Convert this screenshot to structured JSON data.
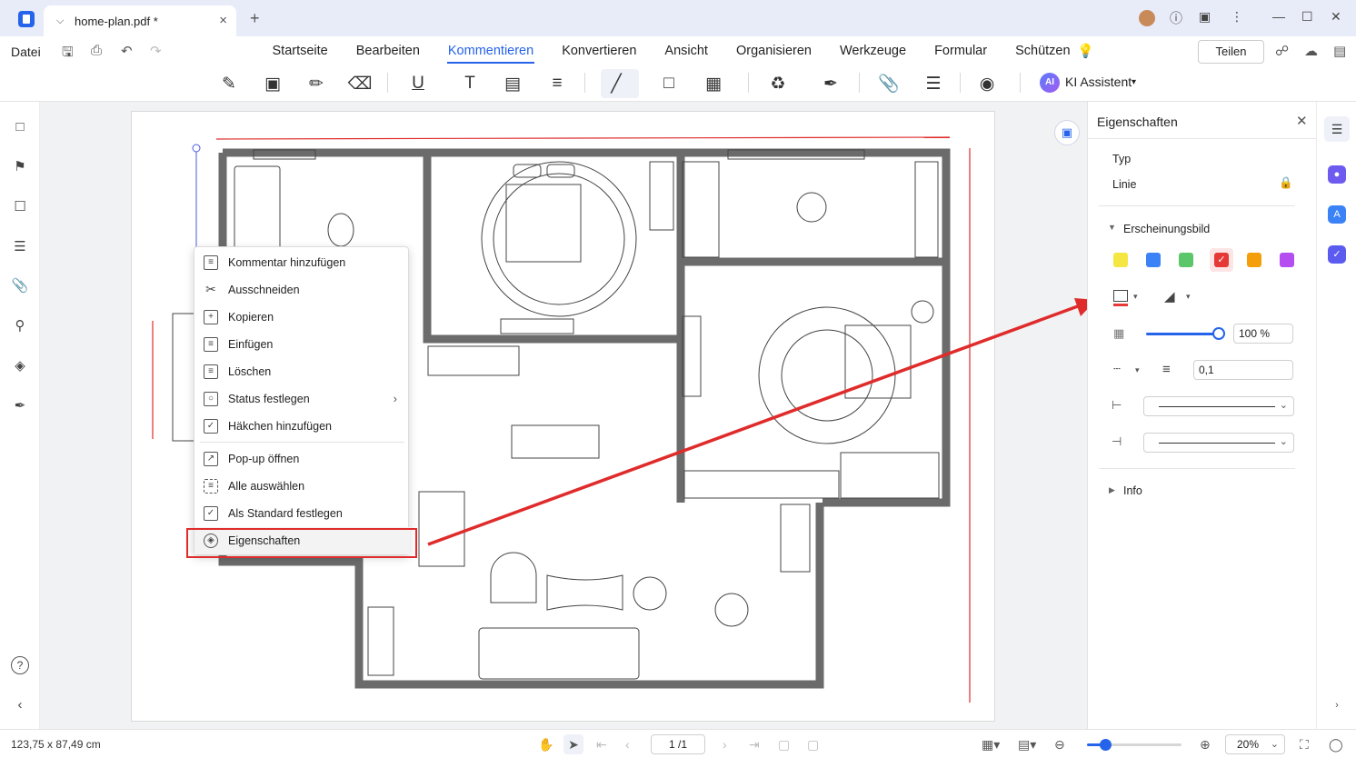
{
  "tab": {
    "title": "home-plan.pdf *"
  },
  "menubar": {
    "file": "Datei",
    "items": [
      "Startseite",
      "Bearbeiten",
      "Kommentieren",
      "Konvertieren",
      "Ansicht",
      "Organisieren",
      "Werkzeuge",
      "Formular",
      "Schützen"
    ],
    "active": "Kommentieren",
    "share": "Teilen"
  },
  "toolbar": {
    "ki_badge": "AI",
    "ki_label": "KI Assistent"
  },
  "context_menu": {
    "items": [
      {
        "label": "Kommentar hinzufügen",
        "icon": "comment-icon"
      },
      {
        "label": "Ausschneiden",
        "icon": "scissors-icon"
      },
      {
        "label": "Kopieren",
        "icon": "copy-icon"
      },
      {
        "label": "Einfügen",
        "icon": "paste-icon"
      },
      {
        "label": "Löschen",
        "icon": "trash-icon"
      },
      {
        "label": "Status festlegen",
        "icon": "status-icon",
        "submenu": true
      },
      {
        "label": "Häkchen hinzufügen",
        "icon": "checkmark-icon"
      },
      {
        "label": "Pop-up öffnen",
        "icon": "popup-icon"
      },
      {
        "label": "Alle auswählen",
        "icon": "select-all-icon"
      },
      {
        "label": "Als Standard festlegen",
        "icon": "set-default-icon"
      },
      {
        "label": "Eigenschaften",
        "icon": "properties-icon",
        "highlighted": true
      }
    ]
  },
  "panel": {
    "title": "Eigenschaften",
    "type_label": "Typ",
    "type_value": "Linie",
    "appearance": "Erscheinungsbild",
    "swatches": [
      "#f5e642",
      "#3b82f6",
      "#5cc66a",
      "#e53935",
      "#f59e0b",
      "#b44ef0"
    ],
    "selected_swatch": "#e53935",
    "opacity": "100 %",
    "opacity_level": 1.0,
    "thickness": "0,1",
    "info": "Info"
  },
  "statusbar": {
    "coords": "123,75 x 87,49 cm",
    "page": "1 /1",
    "zoom": "20%",
    "zoom_level": 0.2
  },
  "annotation": {
    "line_color": "#e02b2b"
  }
}
